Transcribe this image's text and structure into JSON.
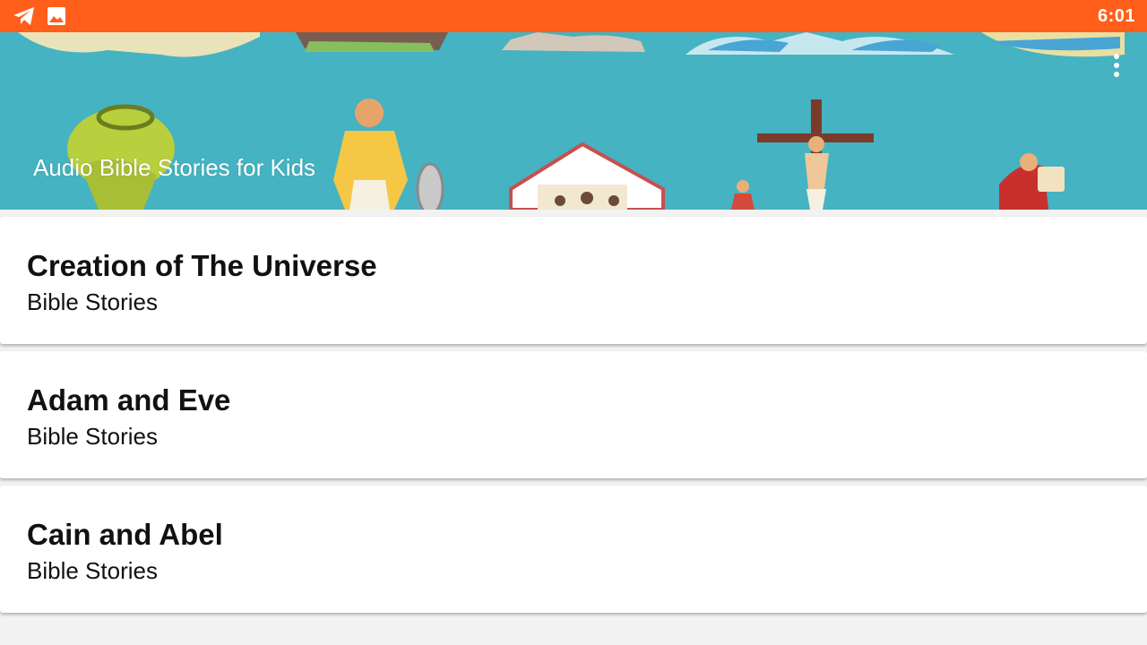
{
  "status_bar": {
    "time": "6:01",
    "icons": [
      "telegram-icon",
      "image-icon"
    ],
    "color": "#ff5f1a"
  },
  "header": {
    "title": "Audio Bible Stories for Kids",
    "background_color": "#45b3c1",
    "menu_icon": "more-vert-icon"
  },
  "stories": [
    {
      "title": "Creation of The Universe",
      "subtitle": "Bible Stories"
    },
    {
      "title": "Adam and Eve",
      "subtitle": "Bible Stories"
    },
    {
      "title": "Cain and Abel",
      "subtitle": "Bible Stories"
    }
  ]
}
